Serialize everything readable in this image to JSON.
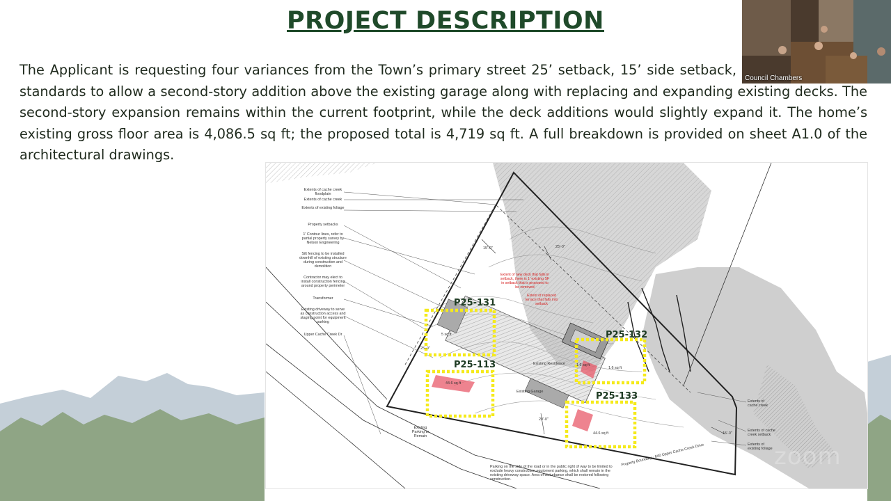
{
  "slide": {
    "title": "PROJECT DESCRIPTION",
    "description": "The Applicant is requesting four variances from the Town’s primary street 25’ setback, 15’ side setback, and creek setback standards to allow a second-story addition above the existing garage along with replacing and expanding existing decks. The second-story expansion remains within the current footprint, while the deck additions would slightly expand it. The home’s existing gross floor area is 4,086.5 sq ft; the proposed total is 4,719 sq ft. A full breakdown is provided on sheet A1.0 of the architectural drawings."
  },
  "plan": {
    "legend_labels": [
      "Extents of cache creek floodplain",
      "Extents of cache creek",
      "Extents of existing foliage",
      "Property setbacks",
      "1' Contour lines, refer to partial property survey by Nelson Engineering",
      "Silt fencing to be installed downhill of existing structure during construction and demolition",
      "Contractor may elect to install construction fencing around property perimeter",
      "Transformer",
      "Existing driveway to serve as construction access and staging point for equipment parking",
      "Upper Cache Creek Dr"
    ],
    "right_labels": [
      "Extents of cache creek",
      "Extents of cache creek setback",
      "Extents of existing foliage"
    ],
    "red_notes": [
      "Extent of new deck that falls in setback, there is 1' existing SF in setback that is proposed to be removed",
      "Extent of replaced terrace that falls into setback"
    ],
    "parcels": [
      "P25-131",
      "P25-132",
      "P25-113",
      "P25-133"
    ],
    "area_labels": [
      "5 sq ft",
      "1.6 sq ft",
      "1.6 sq ft",
      "44.6 sq ft",
      "44.6 sq ft"
    ],
    "parking_note": "Existing Parking to Remain",
    "road_note": "Parking on the side of the road or in the public right of way to be limited to exclude heavy construction equipment parking, which shall remain in the existing driveway space. Area of disturbance shall be restored following construction.",
    "boundary_label": "Property Boundary - 840 Upper Cache Creek Drive",
    "dimensions": [
      "15'-0\"",
      "25'-0\"",
      "20'-0\"",
      "15'-0\"",
      "25'-0\""
    ],
    "structure_labels": [
      "Existing Residence",
      "Existing Garage"
    ]
  },
  "video": {
    "label": "Council Chambers"
  },
  "watermark": "zoom",
  "colors": {
    "title": "#1f4a2a",
    "highlight": "#f5ea1c",
    "red_area": "#e85a6a",
    "mountain_dark": "#8fa585",
    "mountain_light": "#c4cfd8"
  }
}
